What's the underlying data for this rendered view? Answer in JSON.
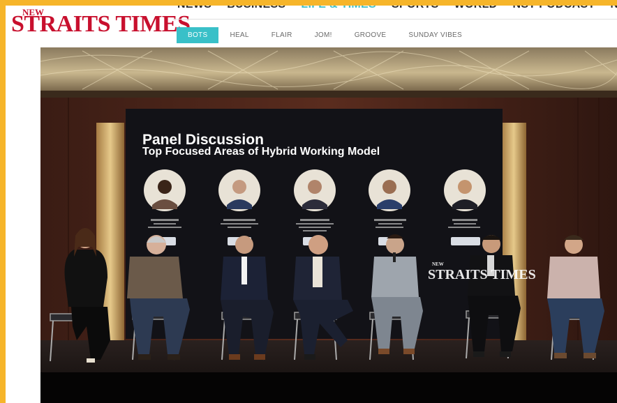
{
  "brand": {
    "logo_new": "NEW",
    "logo_name": "STRAITS TIMES",
    "accent": "#3fc0c9",
    "brand_red": "#c8102e",
    "frame": "#f6b52a"
  },
  "top_nav": {
    "items": [
      {
        "label": "NEWS"
      },
      {
        "label": "BUSINESS"
      },
      {
        "label": "LIFE & TIMES",
        "active": true
      },
      {
        "label": "SPORTS"
      },
      {
        "label": "WORLD"
      },
      {
        "label": "NST PODCAST"
      },
      {
        "label": "NST TV"
      }
    ]
  },
  "sub_nav": {
    "items": [
      {
        "label": "BOTS",
        "active": true
      },
      {
        "label": "HEAL"
      },
      {
        "label": "FLAIR"
      },
      {
        "label": "JOM!"
      },
      {
        "label": "GROOVE"
      },
      {
        "label": "SUNDAY VIBES"
      }
    ]
  },
  "photo": {
    "screen_title": "Panel Discussion",
    "screen_subtitle": "Top Focused Areas of Hybrid Working Model",
    "watermark_new": "NEW",
    "watermark_name": "STRAITS TIMES"
  }
}
